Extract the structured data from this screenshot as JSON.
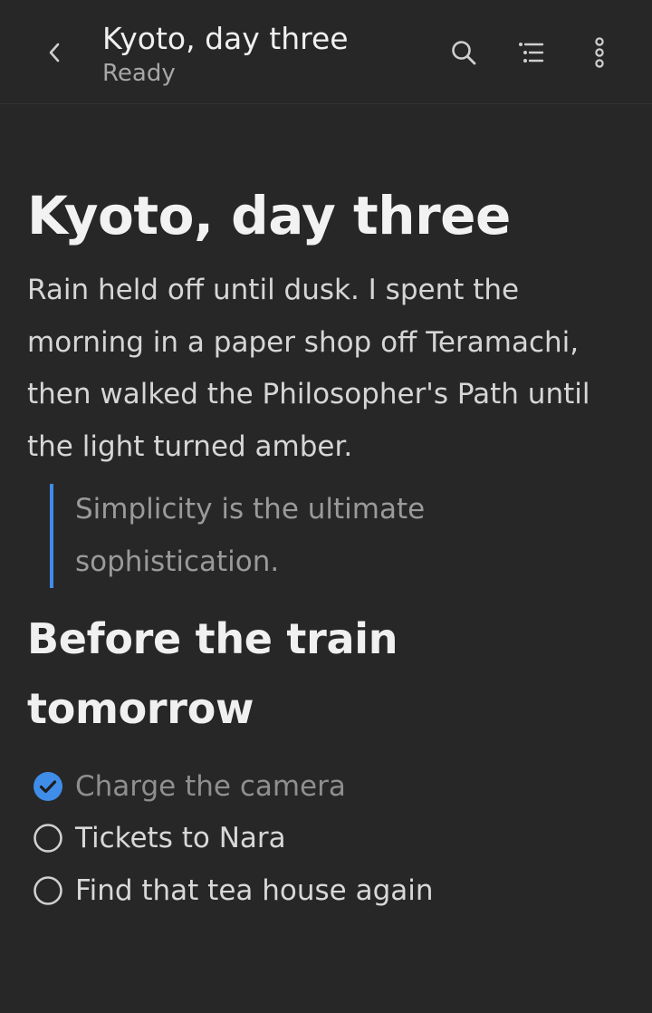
{
  "header": {
    "title": "Kyoto, day three",
    "status": "Ready",
    "icons": [
      "chevron-left-icon",
      "search-icon",
      "outline-icon",
      "more-vertical-icon"
    ]
  },
  "document": {
    "heading": "Kyoto, day three",
    "paragraph": "Rain held off until dusk. I spent the morning in a paper shop off Teramachi, then walked the Philosopher's Path until the light turned amber.",
    "quote": "Simplicity is the ultimate sophistication.",
    "subheading": "Before the train tomorrow",
    "tasks": [
      {
        "label": "Charge the camera",
        "done": true
      },
      {
        "label": "Tickets to Nara",
        "done": false
      },
      {
        "label": "Find that tea house again",
        "done": false
      }
    ]
  },
  "colors": {
    "background": "#272727",
    "accent": "#3f8de8",
    "text": "#d6d6d6",
    "muted": "#9a9a9a"
  }
}
